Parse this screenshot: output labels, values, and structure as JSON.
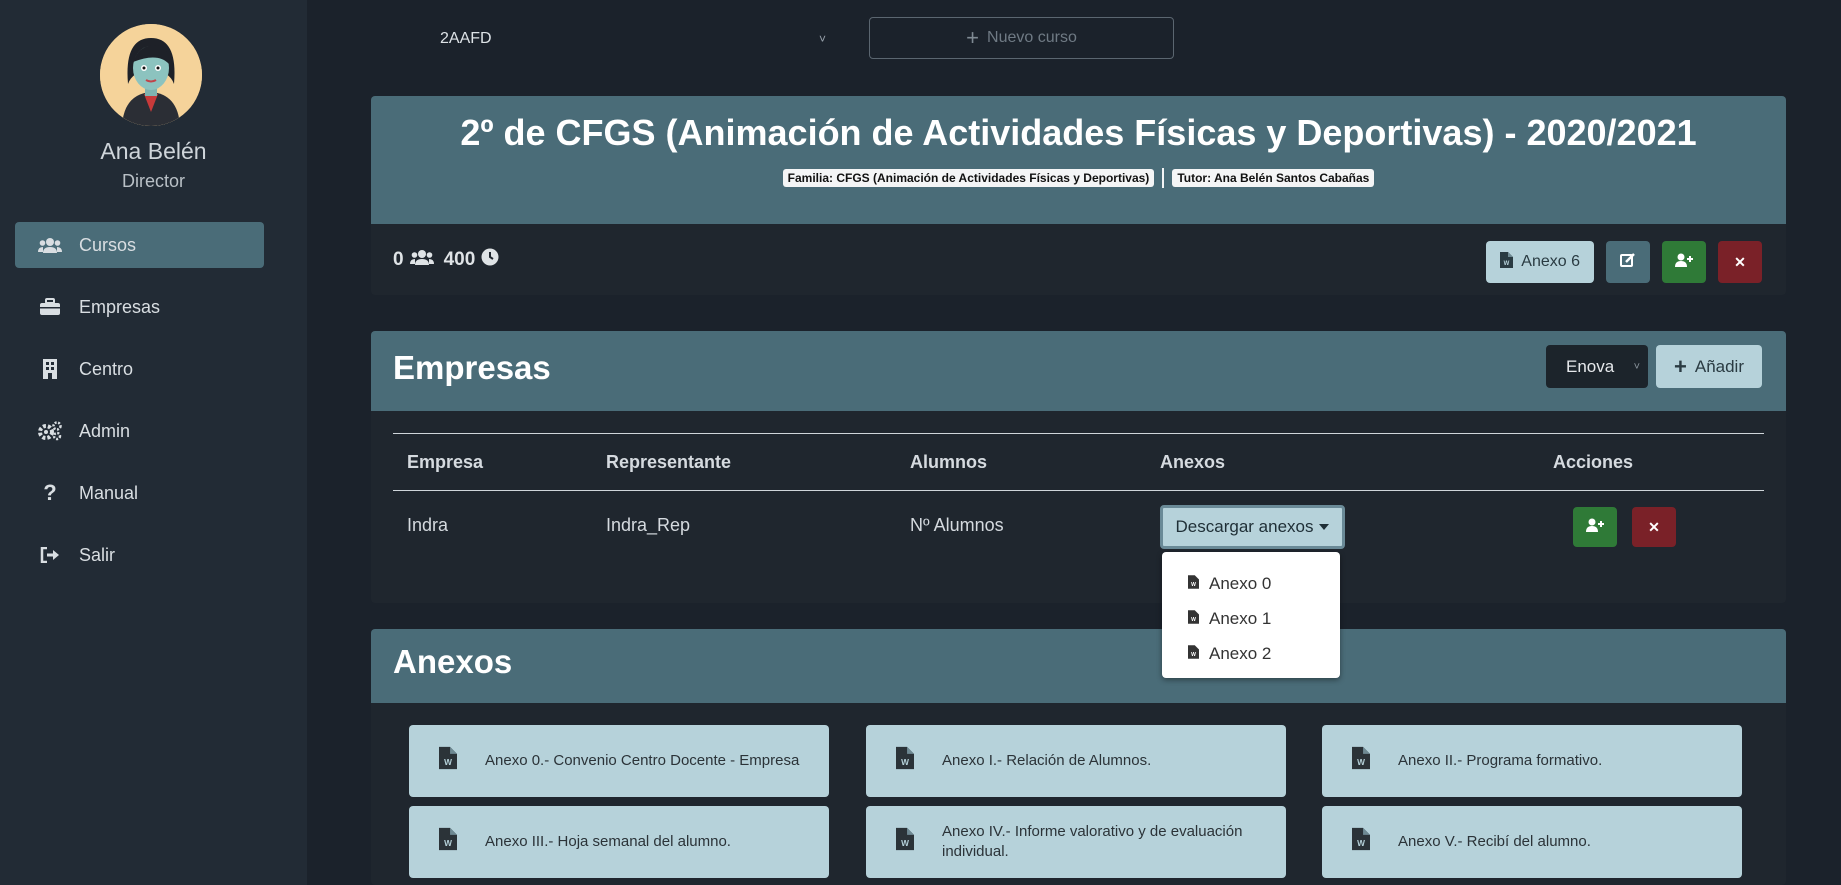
{
  "user": {
    "name": "Ana Belén",
    "role": "Director"
  },
  "nav": [
    {
      "label": "Cursos",
      "icon": "users-icon"
    },
    {
      "label": "Empresas",
      "icon": "briefcase-icon"
    },
    {
      "label": "Centro",
      "icon": "building-icon"
    },
    {
      "label": "Admin",
      "icon": "cogs-icon"
    },
    {
      "label": "Manual",
      "icon": "question-icon"
    },
    {
      "label": "Salir",
      "icon": "sign-out-icon"
    }
  ],
  "topbar": {
    "course_select": "2AAFD",
    "new_course": "Nuevo curso"
  },
  "course": {
    "title": "2º de CFGS (Animación de Actividades Físicas y Deportivas) - 2020/2021",
    "familia": "Familia: CFGS (Animación de Actividades Físicas y Deportivas)",
    "tutor": "Tutor: Ana Belén Santos Cabañas",
    "students": "0",
    "hours": "400",
    "anexo6": "Anexo 6"
  },
  "empresas": {
    "title": "Empresas",
    "select": "Enova",
    "add": "Añadir",
    "headers": [
      "Empresa",
      "Representante",
      "Alumnos",
      "Anexos",
      "Acciones"
    ],
    "rows": [
      {
        "empresa": "Indra",
        "representante": "Indra_Rep",
        "alumnos": "Nº Alumnos",
        "anexos": "Descargar anexos"
      }
    ],
    "dropdown": [
      "Anexo 0",
      "Anexo 1",
      "Anexo 2"
    ]
  },
  "anexos": {
    "title": "Anexos",
    "tiles": [
      "Anexo 0.- Convenio Centro Docente - Empresa",
      "Anexo I.- Relación de Alumnos.",
      "Anexo II.- Programa formativo.",
      "Anexo III.- Hoja semanal del alumno.",
      "Anexo IV.- Informe valorativo y de evaluación individual.",
      "Anexo V.- Recibí del alumno."
    ]
  },
  "colors": {
    "accent": "#4a6c78",
    "light": "#b6d2da",
    "green": "#2f7a37",
    "red": "#7a2128",
    "bg": "#1b222b",
    "sidebar": "#222b35"
  }
}
